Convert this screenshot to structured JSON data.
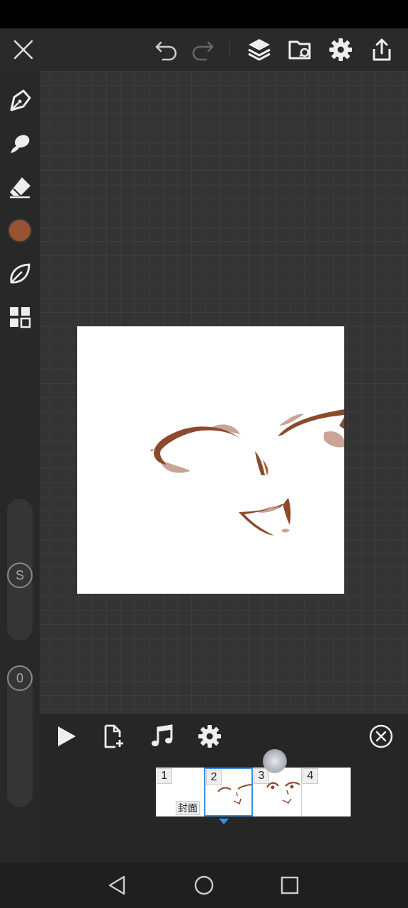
{
  "app": {
    "colors": {
      "brush_color": "#9a5330",
      "accent": "#3a8ee6",
      "stroke_main": "#8b4a2b",
      "stroke_shadow": "#c9a497"
    }
  },
  "topbar": {
    "icons": [
      "close-icon",
      "undo-icon",
      "redo-icon",
      "layers-icon",
      "folder-icon",
      "settings-icon",
      "share-icon"
    ]
  },
  "sidebar": {
    "tools": [
      "pen-icon",
      "smudge-icon",
      "eraser-icon",
      "color-swatch",
      "leaf-icon",
      "grid-icon"
    ],
    "size_slider_label": "S",
    "opacity_slider_label": "0"
  },
  "animation_panel": {
    "icons": [
      "play-icon",
      "add-frame-icon",
      "music-icon",
      "settings-icon",
      "close-circle-icon"
    ],
    "frames": [
      {
        "number": "1",
        "label": "封面"
      },
      {
        "number": "2",
        "label": ""
      },
      {
        "number": "3",
        "label": ""
      },
      {
        "number": "4",
        "label": ""
      }
    ],
    "selected_frame": 2
  },
  "navbar": {
    "icons": [
      "back-icon",
      "home-icon",
      "recents-icon"
    ]
  }
}
